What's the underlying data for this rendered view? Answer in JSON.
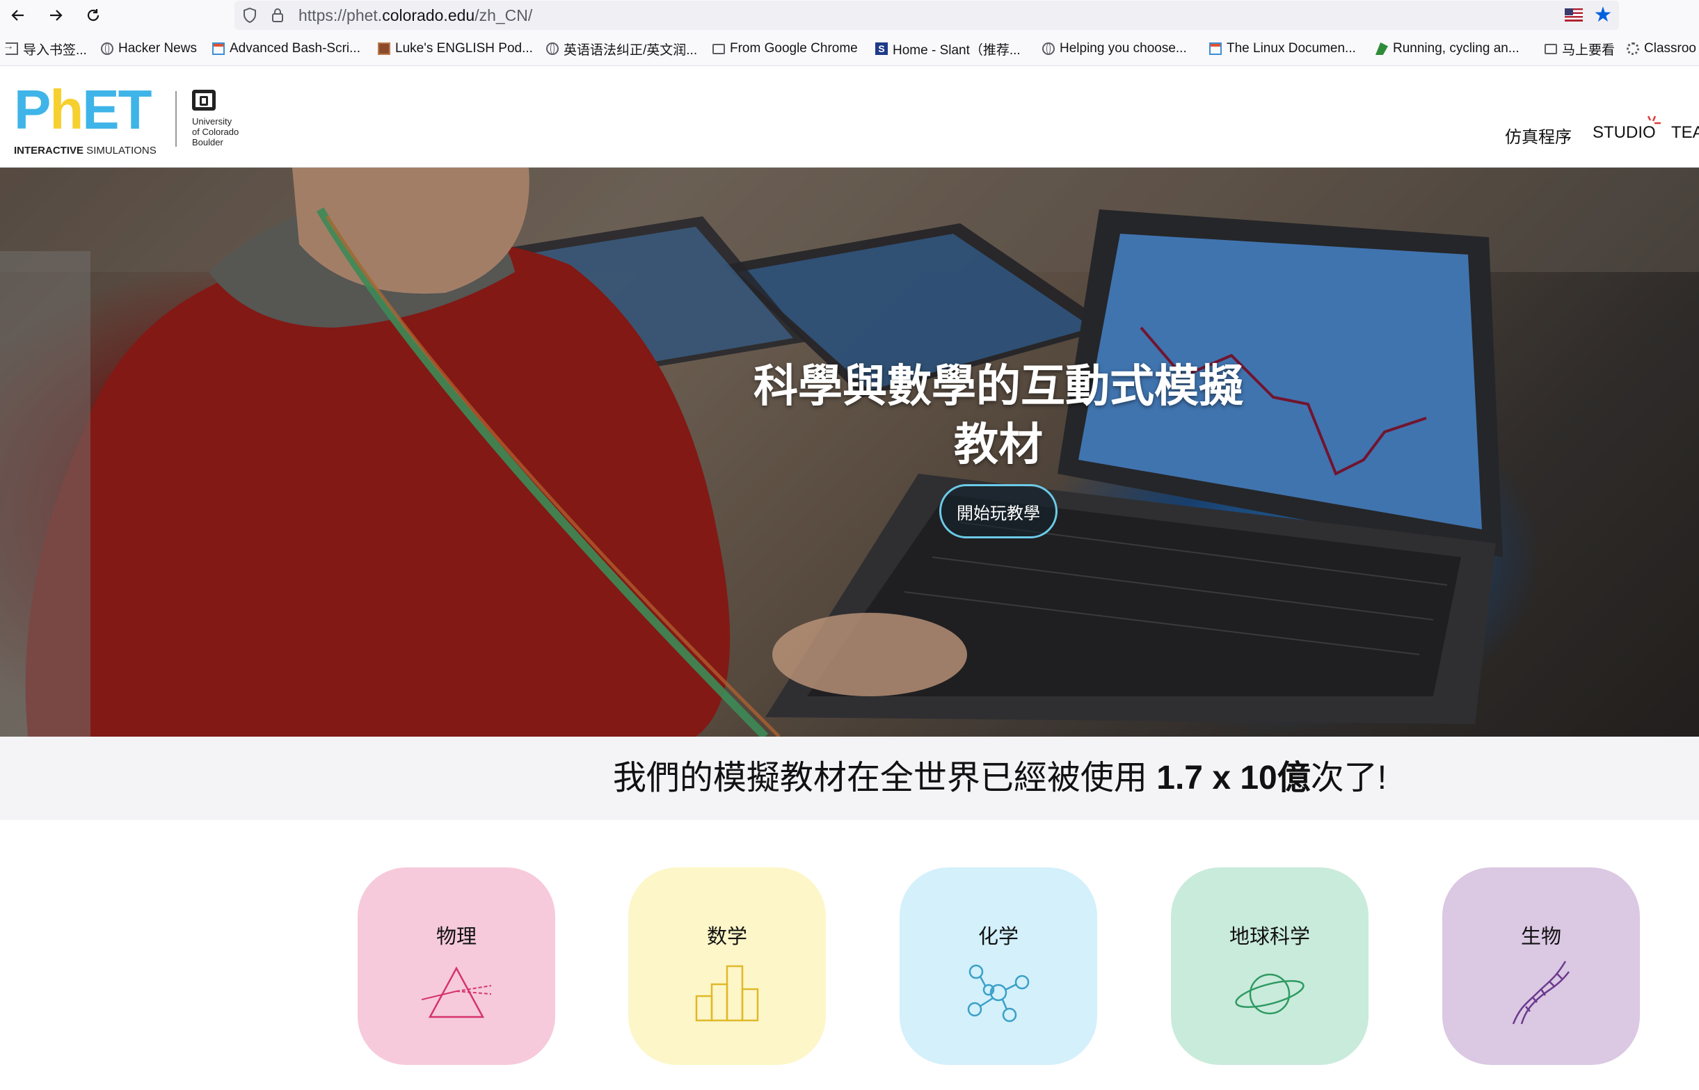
{
  "browser": {
    "url_prefix": "https://phet.",
    "url_host": "colorado.edu",
    "url_suffix": "/zh_CN/"
  },
  "bookmarks": [
    {
      "label": "导入书签...",
      "icon": "import-icon"
    },
    {
      "label": "Hacker News",
      "icon": "globe-icon"
    },
    {
      "label": "Advanced Bash-Scri...",
      "icon": "page-icon"
    },
    {
      "label": "Luke's ENGLISH Pod...",
      "icon": "book-icon"
    },
    {
      "label": "英语语法纠正/英文润...",
      "icon": "globe-icon"
    },
    {
      "label": "From Google Chrome",
      "icon": "folder-icon"
    },
    {
      "label": "Home - Slant（推荐...",
      "icon": "slant-icon"
    },
    {
      "label": "Helping you choose...",
      "icon": "globe-icon"
    },
    {
      "label": "The Linux Documen...",
      "icon": "page-icon"
    },
    {
      "label": "Running, cycling an...",
      "icon": "strava-icon"
    },
    {
      "label": "马上要看",
      "icon": "folder-icon"
    },
    {
      "label": "Classroo",
      "icon": "gear-icon"
    }
  ],
  "header": {
    "logo_main_1": "P",
    "logo_main_2": "h",
    "logo_main_3": "ET",
    "logo_sub_bold": "INTERACTIVE",
    "logo_sub": " SIMULATIONS",
    "cu_line1": "University",
    "cu_line2": "of Colorado",
    "cu_line3": "Boulder",
    "nav": [
      "仿真程序",
      "STUDIO",
      "TEA"
    ]
  },
  "hero": {
    "title_line1": "科學與數學的互動式模擬",
    "title_line2": "教材",
    "button": "開始玩教學"
  },
  "stats": {
    "prefix": "我們的模擬教材在全世界已經被使用 ",
    "count": "1.7 x 10億",
    "suffix": "次了!"
  },
  "categories": [
    {
      "label": "物理",
      "color": "#f6cadb",
      "icon": "prism-icon",
      "icon_color": "#d6336c"
    },
    {
      "label": "数学",
      "color": "#fdf6c8",
      "icon": "bar-chart-icon",
      "icon_color": "#e0b92a"
    },
    {
      "label": "化学",
      "color": "#d3f0fb",
      "icon": "molecule-icon",
      "icon_color": "#3aa0c8"
    },
    {
      "label": "地球科学",
      "color": "#c9ebdb",
      "icon": "planet-icon",
      "icon_color": "#2f9a62"
    },
    {
      "label": "生物",
      "color": "#dbc8e3",
      "icon": "dna-icon",
      "icon_color": "#6b3a8e"
    }
  ]
}
